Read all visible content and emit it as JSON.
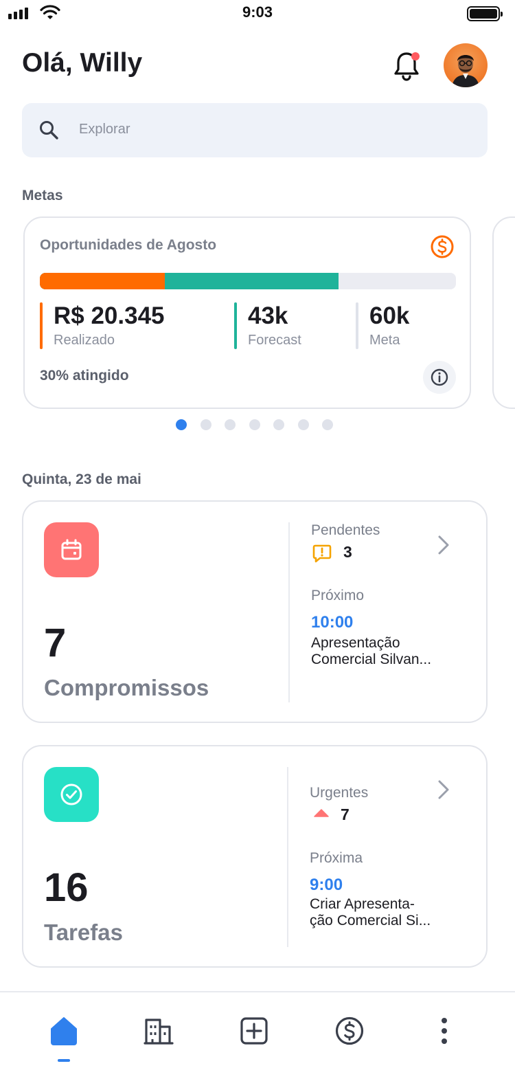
{
  "status_bar": {
    "time": "9:03"
  },
  "header": {
    "greeting": "Olá, Willy"
  },
  "search": {
    "placeholder": "Explorar"
  },
  "goals": {
    "section_title": "Metas",
    "card": {
      "title": "Oportunidades de Agosto",
      "progress": {
        "realized_fraction": 0.3,
        "forecast_fraction": 0.717
      },
      "metrics": [
        {
          "value": "R$ 20.345",
          "label": "Realizado",
          "color": "#ff6b00"
        },
        {
          "value": "43k",
          "label": "Forecast",
          "color": "#1fb39a"
        },
        {
          "value": "60k",
          "label": "Meta",
          "color": "#dfe2ea"
        }
      ],
      "footer": "30% atingido"
    },
    "pagination": {
      "total": 7,
      "active": 0
    }
  },
  "day": {
    "date_label": "Quinta, 23 de mai",
    "appointments": {
      "count": "7",
      "label": "Compromissos",
      "tile_color": "#ff7474",
      "pending_label": "Pendentes",
      "pending_count": "3",
      "next_label": "Próximo",
      "next_time": "10:00",
      "next_desc_1": "Apresentação",
      "next_desc_2": "Comercial Silvan..."
    },
    "tasks": {
      "count": "16",
      "label": "Tarefas",
      "tile_color": "#27e0c6",
      "urgent_label": "Urgentes",
      "urgent_count": "7",
      "next_label": "Próxima",
      "next_time": "9:00",
      "next_desc_1": "Criar Apresenta-",
      "next_desc_2": "ção Comercial Si..."
    }
  },
  "tabbar": {
    "items": [
      {
        "icon": "home-icon",
        "active": true
      },
      {
        "icon": "building-icon",
        "active": false
      },
      {
        "icon": "add-square-icon",
        "active": false
      },
      {
        "icon": "dollar-circle-icon",
        "active": false
      },
      {
        "icon": "more-vertical-icon",
        "active": false
      }
    ]
  },
  "colors": {
    "accent": "#2f80ed",
    "orange": "#ff6b00",
    "teal": "#1fb39a"
  }
}
